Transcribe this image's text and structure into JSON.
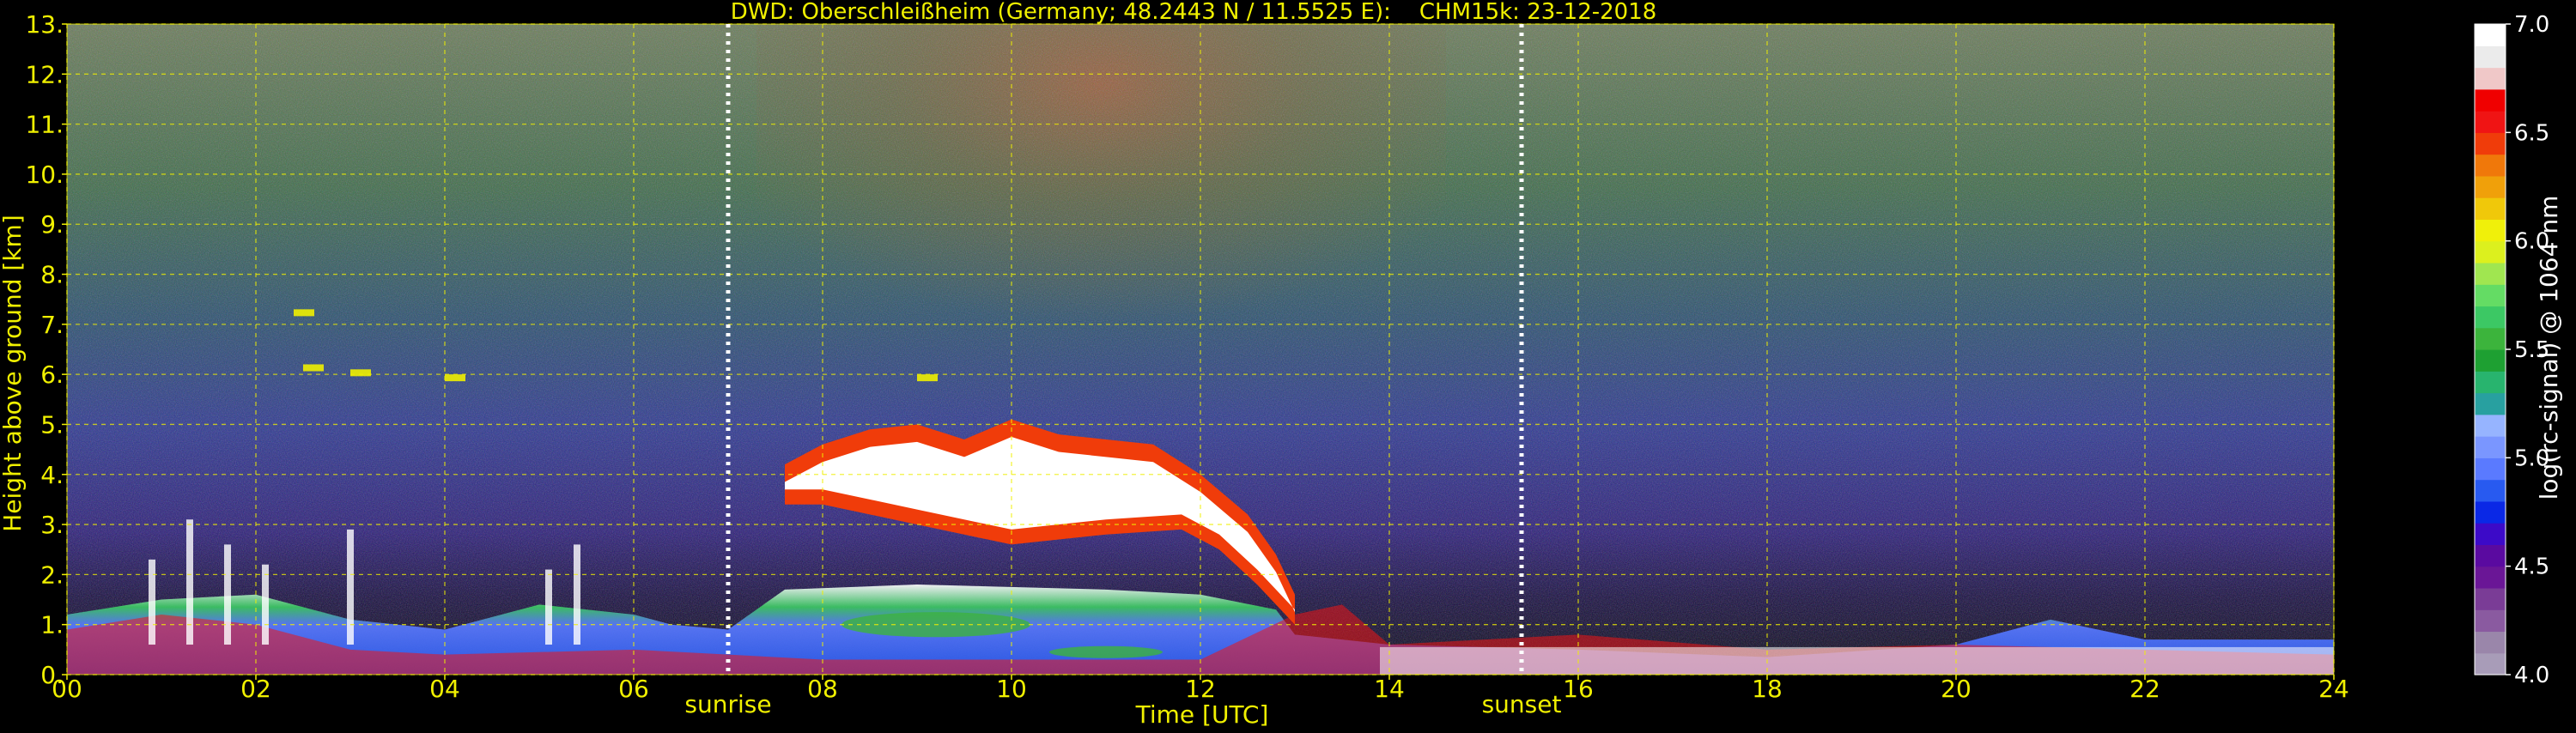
{
  "chart_data": {
    "type": "heatmap",
    "title": "DWD: Oberschleißheim (Germany; 48.2443 N / 11.5525 E):    CHM15k: 23-12-2018",
    "xlabel": "Time [UTC]",
    "ylabel": "Height above ground [km]",
    "colorbar_label": "log(rc-signal) @ 1064 nm",
    "xlim": [
      0,
      24
    ],
    "ylim": [
      0,
      13
    ],
    "color_range": [
      4.0,
      7.0
    ],
    "x_ticks": [
      "00",
      "02",
      "04",
      "06",
      "08",
      "10",
      "12",
      "14",
      "16",
      "18",
      "20",
      "22",
      "24"
    ],
    "y_ticks": [
      "0.",
      "1.",
      "2.",
      "3.",
      "4.",
      "5.",
      "6.",
      "7.",
      "8.",
      "9.",
      "10.",
      "11.",
      "12.",
      "13."
    ],
    "colorbar_ticks": [
      "4.0",
      "4.5",
      "5.0",
      "5.5",
      "6.0",
      "6.5",
      "7.0"
    ],
    "grid": true,
    "events": [
      {
        "name": "sunrise",
        "time": 7.0
      },
      {
        "name": "sunset",
        "time": 15.4
      }
    ],
    "colormap": [
      "#a89cb8",
      "#9a86aa",
      "#8a5aa0",
      "#7a3c96",
      "#6a1696",
      "#5a0aa0",
      "#3c0ac8",
      "#0a28e6",
      "#285af0",
      "#5a7aff",
      "#7a96ff",
      "#96b4ff",
      "#28a0a0",
      "#28b46e",
      "#1ea032",
      "#3cb43c",
      "#3cc864",
      "#64dc64",
      "#a0e650",
      "#dcf01e",
      "#f0f00a",
      "#f0c80a",
      "#f0a00a",
      "#f0780a",
      "#f03c0a",
      "#f01414",
      "#f00000",
      "#f0c8c8",
      "#ebebeb",
      "#ffffff"
    ],
    "colors": {
      "text": "#f0f000",
      "grid": "#f0f000",
      "event_line": "#ffffff",
      "background": "#000000"
    }
  }
}
